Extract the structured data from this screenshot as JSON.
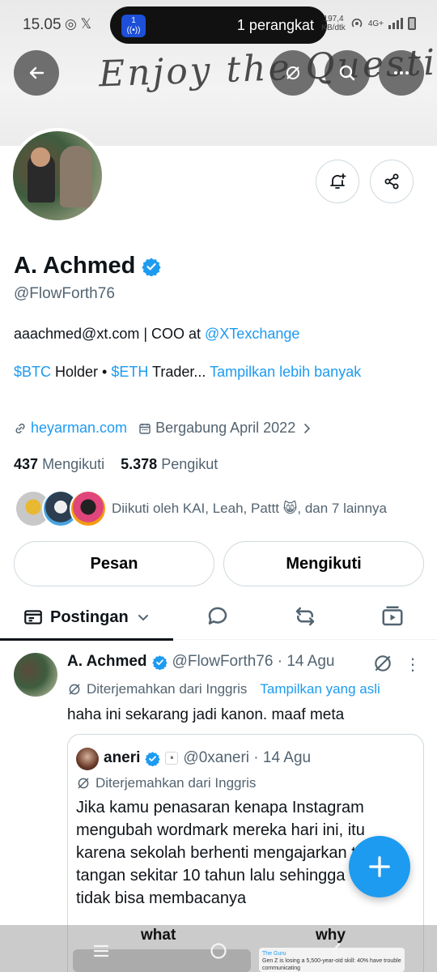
{
  "status_bar": {
    "time": "15.05",
    "left_icons": "◎ 𝕏",
    "island_count": "1",
    "island_text": "1 perangkat",
    "speed": "197,4\nKB/dtk",
    "network": "4G+"
  },
  "banner": {
    "text": "Enjoy the Question"
  },
  "profile": {
    "name": "A. Achmed",
    "handle": "@FlowForth76",
    "bio_line1_prefix": "aaachmed@xt.com | COO at ",
    "bio_line1_link": "@XTexchange",
    "bio_line2_tag1": "$BTC",
    "bio_line2_text1": " Holder • ",
    "bio_line2_tag2": "$ETH",
    "bio_line2_text2": " Trader... ",
    "bio_more": "Tampilkan lebih banyak",
    "website": "heyarman.com",
    "joined": "Bergabung April 2022",
    "following_count": "437",
    "following_label": "Mengikuti",
    "followers_count": "5.378",
    "followers_label": "Pengikut",
    "followed_by": "Diikuti oleh KAI, Leah, Pattt 😸, dan 7 lainnya"
  },
  "actions": {
    "message": "Pesan",
    "following": "Mengikuti"
  },
  "tabs": {
    "active": "Postingan"
  },
  "post": {
    "name": "A. Achmed",
    "handle_date": "@FlowForth76 · 14 Agu",
    "translated": "Diterjemahkan dari Inggris",
    "show_original": "Tampilkan yang asli",
    "text": "haha ini sekarang jadi kanon. maaf meta",
    "quote": {
      "name": "aneri",
      "handle_date": "@0xaneri · 14 Agu",
      "translated": "Diterjemahkan dari Inggris",
      "text": "Jika kamu penasaran kenapa Instagram mengubah wordmark mereka hari ini, itu karena sekolah berhenti mengajarkan tulisan tangan sekitar 10 tahun lalu sehingga GenZ+ tidak bisa membacanya"
    }
  },
  "nav_overlay": {
    "label_left": "what",
    "label_right": "why",
    "thumb_source": "The Guru",
    "thumb_text": "Gen Z is losing a 5,500-year-old skill: 40% have trouble communicating"
  },
  "colors": {
    "accent": "#1d9bf0",
    "text": "#0f1419",
    "secondary": "#536471",
    "border": "#cfd9de"
  }
}
